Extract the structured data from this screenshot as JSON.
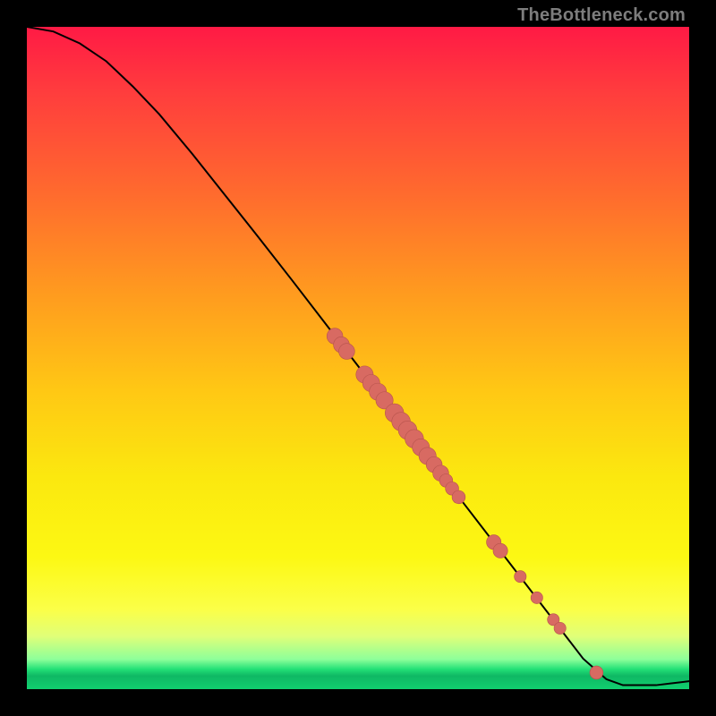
{
  "watermark": "TheBottleneck.com",
  "colors": {
    "marker_fill": "#d86a62",
    "marker_stroke": "#b6534c",
    "curve": "#000000",
    "background_black": "#000000"
  },
  "chart_data": {
    "type": "line",
    "title": "",
    "xlabel": "",
    "ylabel": "",
    "xlim": [
      0,
      100
    ],
    "ylim": [
      0,
      100
    ],
    "grid": false,
    "curve_points": [
      {
        "x": 0.0,
        "y": 100.0
      },
      {
        "x": 4.0,
        "y": 99.3
      },
      {
        "x": 8.0,
        "y": 97.5
      },
      {
        "x": 12.0,
        "y": 94.8
      },
      {
        "x": 16.0,
        "y": 91.0
      },
      {
        "x": 20.0,
        "y": 86.8
      },
      {
        "x": 25.0,
        "y": 80.8
      },
      {
        "x": 30.0,
        "y": 74.5
      },
      {
        "x": 35.0,
        "y": 68.2
      },
      {
        "x": 40.0,
        "y": 61.8
      },
      {
        "x": 45.0,
        "y": 55.3
      },
      {
        "x": 50.0,
        "y": 48.8
      },
      {
        "x": 55.0,
        "y": 42.3
      },
      {
        "x": 60.0,
        "y": 35.8
      },
      {
        "x": 65.0,
        "y": 29.3
      },
      {
        "x": 70.0,
        "y": 22.8
      },
      {
        "x": 75.0,
        "y": 16.3
      },
      {
        "x": 80.0,
        "y": 9.8
      },
      {
        "x": 84.0,
        "y": 4.6
      },
      {
        "x": 87.5,
        "y": 1.5
      },
      {
        "x": 90.0,
        "y": 0.6
      },
      {
        "x": 95.0,
        "y": 0.6
      },
      {
        "x": 100.0,
        "y": 1.2
      }
    ],
    "markers": [
      {
        "x": 46.5,
        "y": 53.3,
        "r": 1.2
      },
      {
        "x": 47.5,
        "y": 52.0,
        "r": 1.2
      },
      {
        "x": 48.3,
        "y": 51.0,
        "r": 1.2
      },
      {
        "x": 51.0,
        "y": 47.5,
        "r": 1.3
      },
      {
        "x": 52.0,
        "y": 46.2,
        "r": 1.3
      },
      {
        "x": 53.0,
        "y": 44.9,
        "r": 1.3
      },
      {
        "x": 54.0,
        "y": 43.6,
        "r": 1.3
      },
      {
        "x": 55.5,
        "y": 41.7,
        "r": 1.4
      },
      {
        "x": 56.5,
        "y": 40.4,
        "r": 1.4
      },
      {
        "x": 57.5,
        "y": 39.1,
        "r": 1.4
      },
      {
        "x": 58.5,
        "y": 37.8,
        "r": 1.4
      },
      {
        "x": 59.5,
        "y": 36.5,
        "r": 1.3
      },
      {
        "x": 60.5,
        "y": 35.2,
        "r": 1.3
      },
      {
        "x": 61.5,
        "y": 33.9,
        "r": 1.2
      },
      {
        "x": 62.5,
        "y": 32.6,
        "r": 1.2
      },
      {
        "x": 63.3,
        "y": 31.5,
        "r": 1.0
      },
      {
        "x": 64.2,
        "y": 30.3,
        "r": 1.0
      },
      {
        "x": 65.2,
        "y": 29.0,
        "r": 1.0
      },
      {
        "x": 70.5,
        "y": 22.2,
        "r": 1.1
      },
      {
        "x": 71.5,
        "y": 20.9,
        "r": 1.1
      },
      {
        "x": 74.5,
        "y": 17.0,
        "r": 0.9
      },
      {
        "x": 77.0,
        "y": 13.8,
        "r": 0.9
      },
      {
        "x": 79.5,
        "y": 10.5,
        "r": 0.9
      },
      {
        "x": 80.5,
        "y": 9.2,
        "r": 0.9
      },
      {
        "x": 86.0,
        "y": 2.5,
        "r": 1.0
      }
    ]
  }
}
